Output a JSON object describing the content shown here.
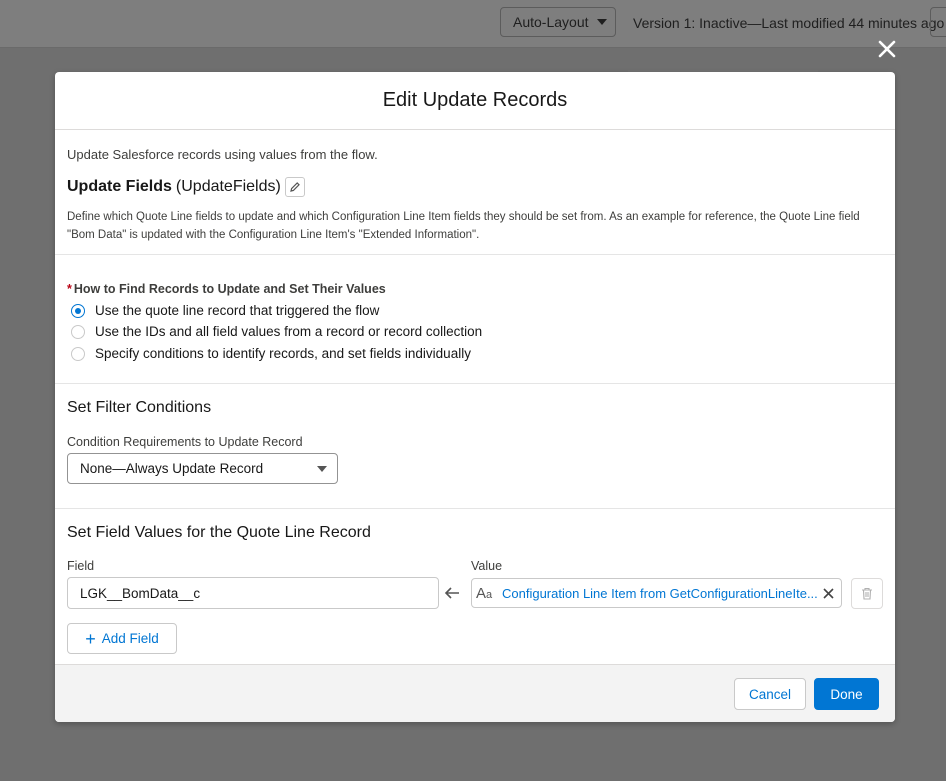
{
  "background": {
    "auto_layout_label": "Auto-Layout",
    "version_text": "Version 1: Inactive—Last modified 44 minutes ago"
  },
  "modal": {
    "title": "Edit Update Records",
    "intro": {
      "description": "Update Salesforce records using values from the flow.",
      "element_label": "Update Fields",
      "element_api": "(UpdateFields)",
      "help_text": "Define which Quote Line fields to update and which Configuration Line Item fields they should be set from. As an example for reference, the Quote Line field \"Bom Data\" is updated with the Configuration Line Item's \"Extended Information\"."
    },
    "how_to_find": {
      "required_marker": "*",
      "label": "How to Find Records to Update and Set Their Values",
      "options": [
        {
          "label": "Use the quote line record that triggered the flow",
          "checked": true
        },
        {
          "label": "Use the IDs and all field values from a record or record collection",
          "checked": false
        },
        {
          "label": "Specify conditions to identify records, and set fields individually",
          "checked": false
        }
      ]
    },
    "filter": {
      "title": "Set Filter Conditions",
      "requirement_label": "Condition Requirements to Update Record",
      "requirement_value": "None—Always Update Record"
    },
    "field_values": {
      "title": "Set Field Values for the Quote Line Record",
      "field_label": "Field",
      "value_label": "Value",
      "rows": [
        {
          "field": "LGK__BomData__c",
          "value": "Configuration Line Item from GetConfigurationLineIte..."
        }
      ],
      "add_field_label": "Add Field"
    },
    "footer": {
      "cancel_label": "Cancel",
      "done_label": "Done"
    }
  },
  "colors": {
    "brand": "#0176d3",
    "overlay": "#6f6f6f",
    "required": "#ba0517"
  }
}
